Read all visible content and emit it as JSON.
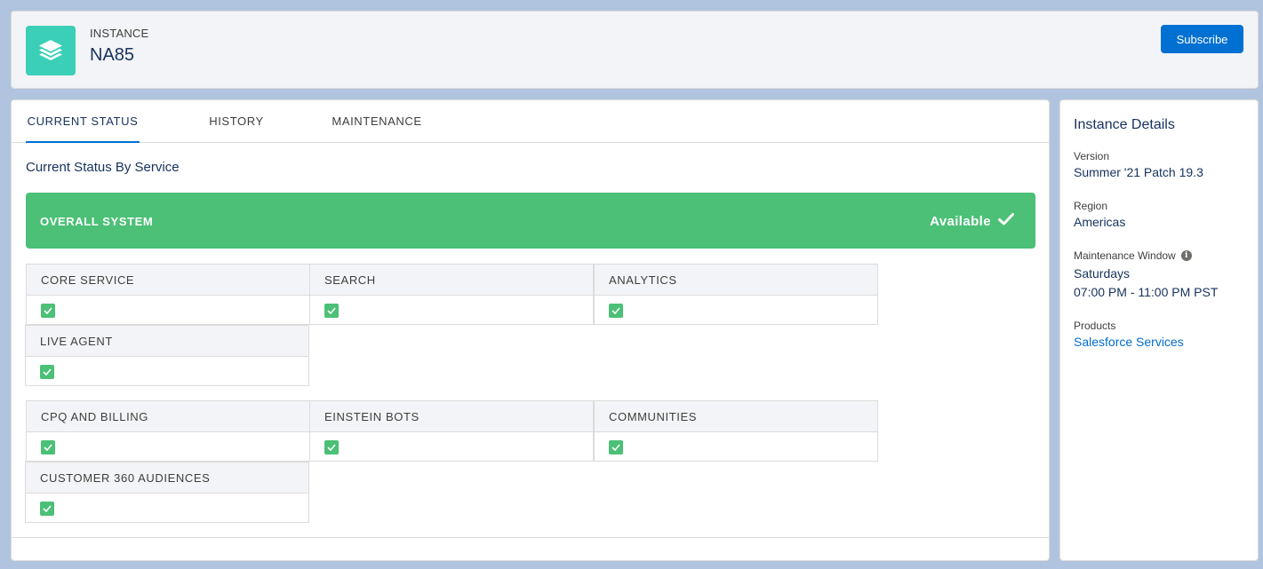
{
  "header": {
    "icon": "stacked-layers-icon",
    "eyebrow": "INSTANCE",
    "title": "NA85",
    "subscribe_label": "Subscribe"
  },
  "tabs": [
    {
      "label": "CURRENT STATUS",
      "active": true
    },
    {
      "label": "HISTORY",
      "active": false
    },
    {
      "label": "MAINTENANCE",
      "active": false
    }
  ],
  "current_status": {
    "title": "Current Status By Service",
    "overall": {
      "label": "OVERALL SYSTEM",
      "status": "Available"
    },
    "services": [
      {
        "name": "CORE SERVICE",
        "status": "ok"
      },
      {
        "name": "SEARCH",
        "status": "ok"
      },
      {
        "name": "ANALYTICS",
        "status": "ok"
      },
      {
        "name": "LIVE AGENT",
        "status": "ok"
      },
      {
        "name": "CPQ AND BILLING",
        "status": "ok"
      },
      {
        "name": "EINSTEIN BOTS",
        "status": "ok"
      },
      {
        "name": "COMMUNITIES",
        "status": "ok"
      },
      {
        "name": "CUSTOMER 360 AUDIENCES",
        "status": "ok"
      }
    ]
  },
  "details": {
    "title": "Instance Details",
    "version_label": "Version",
    "version_value": "Summer '21 Patch 19.3",
    "region_label": "Region",
    "region_value": "Americas",
    "maintenance_label": "Maintenance Window",
    "maintenance_day": "Saturdays",
    "maintenance_time": "07:00 PM - 11:00 PM PST",
    "products_label": "Products",
    "products_value": "Salesforce Services"
  },
  "colors": {
    "available": "#4bc076",
    "brand": "#0070d2",
    "icon_bg": "#3bcfb8"
  }
}
